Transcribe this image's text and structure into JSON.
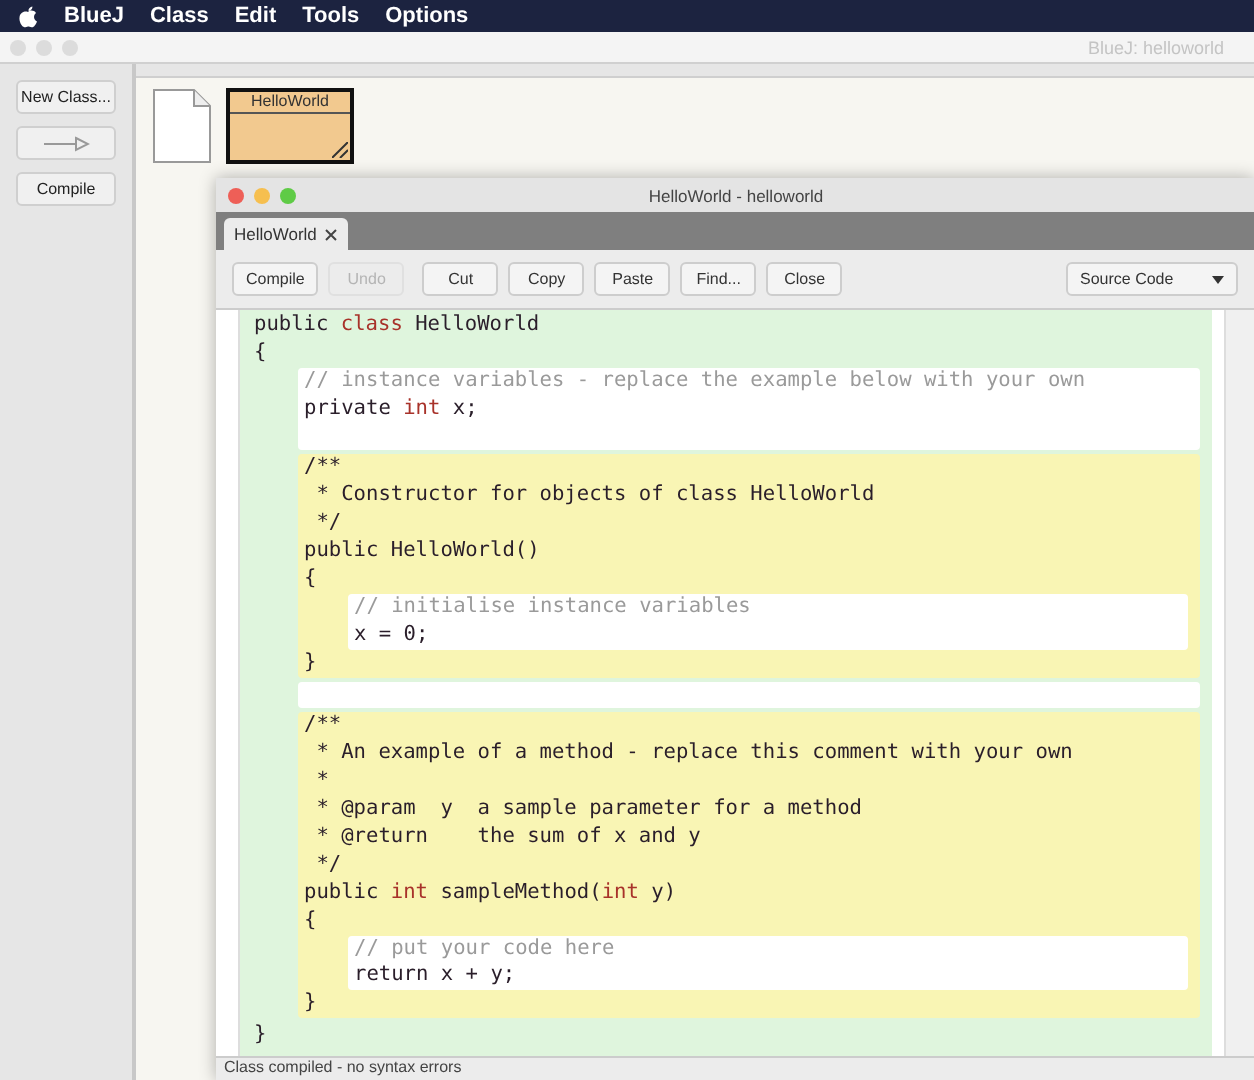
{
  "menu_bar": {
    "app": "BlueJ",
    "items": [
      "Class",
      "Edit",
      "Tools",
      "Options"
    ]
  },
  "main_window": {
    "title": "BlueJ:  helloworld"
  },
  "side_buttons": [
    {
      "kind": "text",
      "label": "New Class..."
    },
    {
      "kind": "arrow"
    },
    {
      "kind": "text",
      "label": "Compile"
    }
  ],
  "classes": [
    {
      "kind": "document"
    },
    {
      "kind": "class",
      "name": "HelloWorld"
    }
  ],
  "editor": {
    "title": "HelloWorld - helloworld",
    "tabs": [
      {
        "label": "HelloWorld",
        "selected": true
      }
    ],
    "toolbar": [
      {
        "label": "Compile",
        "disabled": false
      },
      {
        "label": "Undo",
        "disabled": true
      },
      {
        "label": "Cut",
        "disabled": false
      },
      {
        "label": "Copy",
        "disabled": false
      },
      {
        "label": "Paste",
        "disabled": false
      },
      {
        "label": "Find...",
        "disabled": false
      },
      {
        "label": "Close",
        "disabled": false
      }
    ],
    "view_select": "Source Code",
    "code": {
      "kind": "class",
      "items": [
        {
          "kind": "line",
          "tokens": [
            {
              "text": "public ",
              "kind": "plain"
            },
            {
              "text": "class",
              "kind": "keyword"
            },
            {
              "text": " HelloWorld",
              "kind": "plain"
            }
          ]
        },
        {
          "kind": "line",
          "tokens": [
            {
              "text": "{",
              "kind": "plain"
            }
          ]
        },
        {
          "kind": "field",
          "items": [
            {
              "kind": "line",
              "tokens": [
                {
                  "text": "// instance variables - replace the example below with your own",
                  "kind": "comment"
                }
              ]
            },
            {
              "kind": "line",
              "tokens": [
                {
                  "text": "private ",
                  "kind": "plain"
                },
                {
                  "text": "int",
                  "kind": "keyword"
                },
                {
                  "text": " x;",
                  "kind": "plain"
                }
              ]
            },
            {
              "kind": "blank"
            }
          ]
        },
        {
          "kind": "method",
          "items": [
            {
              "kind": "line",
              "tokens": [
                {
                  "text": "/**",
                  "kind": "plain"
                }
              ]
            },
            {
              "kind": "line",
              "tokens": [
                {
                  "text": " * Constructor for objects of class HelloWorld",
                  "kind": "plain"
                }
              ]
            },
            {
              "kind": "line",
              "tokens": [
                {
                  "text": " */",
                  "kind": "plain"
                }
              ]
            },
            {
              "kind": "line",
              "tokens": [
                {
                  "text": "public HelloWorld()",
                  "kind": "plain"
                }
              ]
            },
            {
              "kind": "line",
              "tokens": [
                {
                  "text": "{",
                  "kind": "plain"
                }
              ]
            },
            {
              "kind": "body",
              "items": [
                {
                  "kind": "line",
                  "tokens": [
                    {
                      "text": "// initialise instance variables",
                      "kind": "comment"
                    }
                  ]
                },
                {
                  "kind": "line",
                  "tokens": [
                    {
                      "text": "x = 0;",
                      "kind": "plain"
                    }
                  ]
                }
              ]
            },
            {
              "kind": "line",
              "tokens": [
                {
                  "text": "}",
                  "kind": "plain"
                }
              ]
            }
          ]
        },
        {
          "kind": "field",
          "items": [
            {
              "kind": "blank"
            }
          ]
        },
        {
          "kind": "method",
          "items": [
            {
              "kind": "line",
              "tokens": [
                {
                  "text": "/**",
                  "kind": "plain"
                }
              ]
            },
            {
              "kind": "line",
              "tokens": [
                {
                  "text": " * An example of a method - replace this comment with your own",
                  "kind": "plain"
                }
              ]
            },
            {
              "kind": "line",
              "tokens": [
                {
                  "text": " *",
                  "kind": "plain"
                }
              ]
            },
            {
              "kind": "line",
              "tokens": [
                {
                  "text": " * @param  y  a sample parameter for a method",
                  "kind": "plain"
                }
              ]
            },
            {
              "kind": "line",
              "tokens": [
                {
                  "text": " * @return    the sum of x and y",
                  "kind": "plain"
                }
              ]
            },
            {
              "kind": "line",
              "tokens": [
                {
                  "text": " */",
                  "kind": "plain"
                }
              ]
            },
            {
              "kind": "line",
              "tokens": [
                {
                  "text": "public ",
                  "kind": "plain"
                },
                {
                  "text": "int",
                  "kind": "keyword"
                },
                {
                  "text": " sampleMethod(",
                  "kind": "plain"
                },
                {
                  "text": "int",
                  "kind": "keyword"
                },
                {
                  "text": " y)",
                  "kind": "plain"
                }
              ]
            },
            {
              "kind": "line",
              "tokens": [
                {
                  "text": "{",
                  "kind": "plain"
                }
              ]
            },
            {
              "kind": "body",
              "items": [
                {
                  "kind": "line",
                  "tokens": [
                    {
                      "text": "// put your code here",
                      "kind": "comment"
                    }
                  ]
                },
                {
                  "kind": "line",
                  "tokens": [
                    {
                      "text": "return x + y;",
                      "kind": "plain"
                    }
                  ]
                }
              ]
            },
            {
              "kind": "line",
              "tokens": [
                {
                  "text": "}",
                  "kind": "plain"
                }
              ]
            }
          ]
        },
        {
          "kind": "line",
          "tokens": [
            {
              "text": "}",
              "kind": "plain"
            }
          ]
        }
      ]
    },
    "status": "Class compiled - no syntax errors"
  }
}
